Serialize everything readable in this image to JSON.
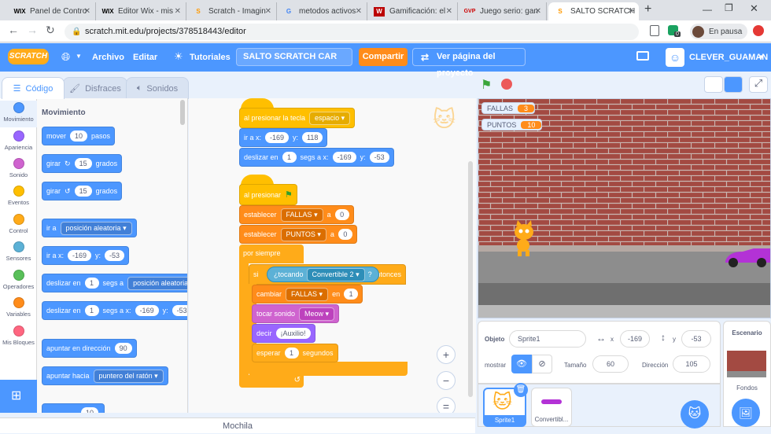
{
  "browser": {
    "tabs": [
      {
        "icon": "WIX",
        "title": "Panel de Contro"
      },
      {
        "icon": "WIX",
        "title": "Editor Wix - mis"
      },
      {
        "icon": "S",
        "title": "Scratch - Imagin"
      },
      {
        "icon": "G",
        "title": "metodos activos"
      },
      {
        "icon": "W",
        "title": "Gamificación: el"
      },
      {
        "icon": "GVP",
        "title": "Juego serio: gan"
      },
      {
        "icon": "S",
        "title": "SALTO SCRATCH"
      }
    ],
    "url": "scratch.mit.edu/projects/378518443/editor",
    "profile_label": "En pausa",
    "ext_badge": "0"
  },
  "header": {
    "logo": "SCRATCH",
    "menu_file": "Archivo",
    "menu_edit": "Editar",
    "tutorials": "Tutoriales",
    "project_title": "SALTO SCRATCH CAR",
    "share": "Compartir",
    "view_project": "Ver página del proyecto",
    "username": "CLEVER_GUAMAN"
  },
  "tabs": {
    "code": "Código",
    "costumes": "Disfraces",
    "sounds": "Sonidos"
  },
  "categories": [
    {
      "label": "Movimiento",
      "color": "#4c97ff"
    },
    {
      "label": "Apariencia",
      "color": "#9966ff"
    },
    {
      "label": "Sonido",
      "color": "#cf63cf"
    },
    {
      "label": "Eventos",
      "color": "#ffbf00"
    },
    {
      "label": "Control",
      "color": "#ffab19"
    },
    {
      "label": "Sensores",
      "color": "#5cb1d6"
    },
    {
      "label": "Operadores",
      "color": "#59c059"
    },
    {
      "label": "Variables",
      "color": "#ff8c1a"
    },
    {
      "label": "Mis Bloques",
      "color": "#ff6680"
    }
  ],
  "palette": {
    "heading": "Movimiento",
    "move": {
      "a": "mover",
      "n": "10",
      "b": "pasos"
    },
    "turn_right": {
      "a": "girar",
      "n": "15",
      "b": "grados"
    },
    "turn_left": {
      "a": "girar",
      "n": "15",
      "b": "grados"
    },
    "goto": {
      "a": "ir a",
      "dd": "posición aleatoria"
    },
    "goto_xy": {
      "a": "ir a x:",
      "x": "-169",
      "y_label": "y:",
      "y": "-53"
    },
    "glide": {
      "a": "deslizar en",
      "n": "1",
      "b": "segs a",
      "dd": "posición aleatoria"
    },
    "glide_xy": {
      "a": "deslizar en",
      "n": "1",
      "b": "segs a x:",
      "x": "-169",
      "y_label": "y:",
      "y": "-53"
    },
    "point_dir": {
      "a": "apuntar en dirección",
      "n": "90"
    },
    "point_to": {
      "a": "apuntar hacia",
      "dd": "puntero del ratón"
    },
    "partial": "10"
  },
  "script1": {
    "hat": {
      "a": "al presionar la tecla",
      "dd": "espacio"
    },
    "goto": {
      "a": "ir a x:",
      "x": "-169",
      "y_label": "y:",
      "y": "118"
    },
    "glide": {
      "a": "deslizar en",
      "n": "1",
      "b": "segs a x:",
      "x": "-169",
      "y_label": "y:",
      "y": "-53"
    }
  },
  "script2": {
    "hat": {
      "a": "al presionar"
    },
    "set1": {
      "a": "establecer",
      "dd": "FALLAS",
      "b": "a",
      "n": "0"
    },
    "set2": {
      "a": "establecer",
      "dd": "PUNTOS",
      "b": "a",
      "n": "0"
    },
    "forever": "por siempre",
    "if": {
      "a": "si",
      "touching": "¿tocando",
      "dd": "Convertible 2",
      "q": "?",
      "b": "entonces"
    },
    "change": {
      "a": "cambiar",
      "dd": "FALLAS",
      "b": "en",
      "n": "1"
    },
    "sound": {
      "a": "tocar sonido",
      "dd": "Meow"
    },
    "say": {
      "a": "decir",
      "msg": "¡Auxilio!"
    },
    "wait": {
      "a": "esperar",
      "n": "1",
      "b": "segundos"
    }
  },
  "zoom": {
    "in": "+",
    "out": "−",
    "reset": "="
  },
  "monitors": {
    "fallas_label": "FALLAS",
    "fallas_value": "3",
    "puntos_label": "PUNTOS",
    "puntos_value": "10"
  },
  "sprite_info": {
    "sprite_label": "Objeto",
    "sprite_name": "Sprite1",
    "x_label": "x",
    "x": "-169",
    "y_label": "y",
    "y": "-53",
    "show_label": "mostrar",
    "size_label": "Tamaño",
    "size": "60",
    "dir_label": "Dirección",
    "direction": "105"
  },
  "sprites": [
    {
      "name": "Sprite1"
    },
    {
      "name": "Convertibl..."
    }
  ],
  "stage_panel": {
    "title": "Escenario",
    "backdrops_label": "Fondos"
  },
  "backpack": "Mochila"
}
